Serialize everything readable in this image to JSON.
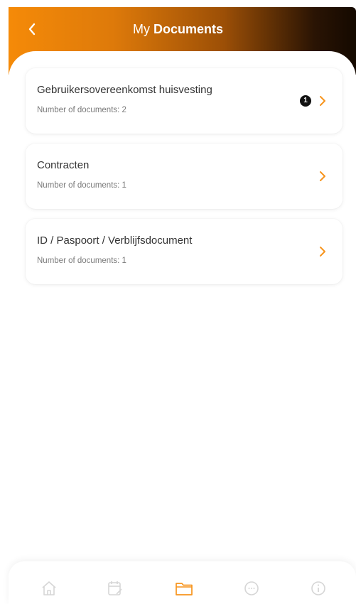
{
  "header": {
    "title_prefix": "My",
    "title_bold": "Documents"
  },
  "categories": [
    {
      "title": "Gebruikersovereenkomst huisvesting",
      "subtitle": "Number of documents: 2",
      "badge": "1"
    },
    {
      "title": "Contracten",
      "subtitle": "Number of documents: 1"
    },
    {
      "title": "ID / Paspoort / Verblijfsdocument",
      "subtitle": "Number of documents: 1"
    }
  ],
  "nav": {
    "items": [
      "home-icon",
      "calendar-edit-icon",
      "folder-icon",
      "chat-icon",
      "info-icon"
    ],
    "active": "folder-icon"
  },
  "colors": {
    "accent": "#f7941d",
    "header_gradient_start": "#f58a08",
    "header_gradient_end": "#140900",
    "nav_inactive": "#d6d6d6"
  }
}
